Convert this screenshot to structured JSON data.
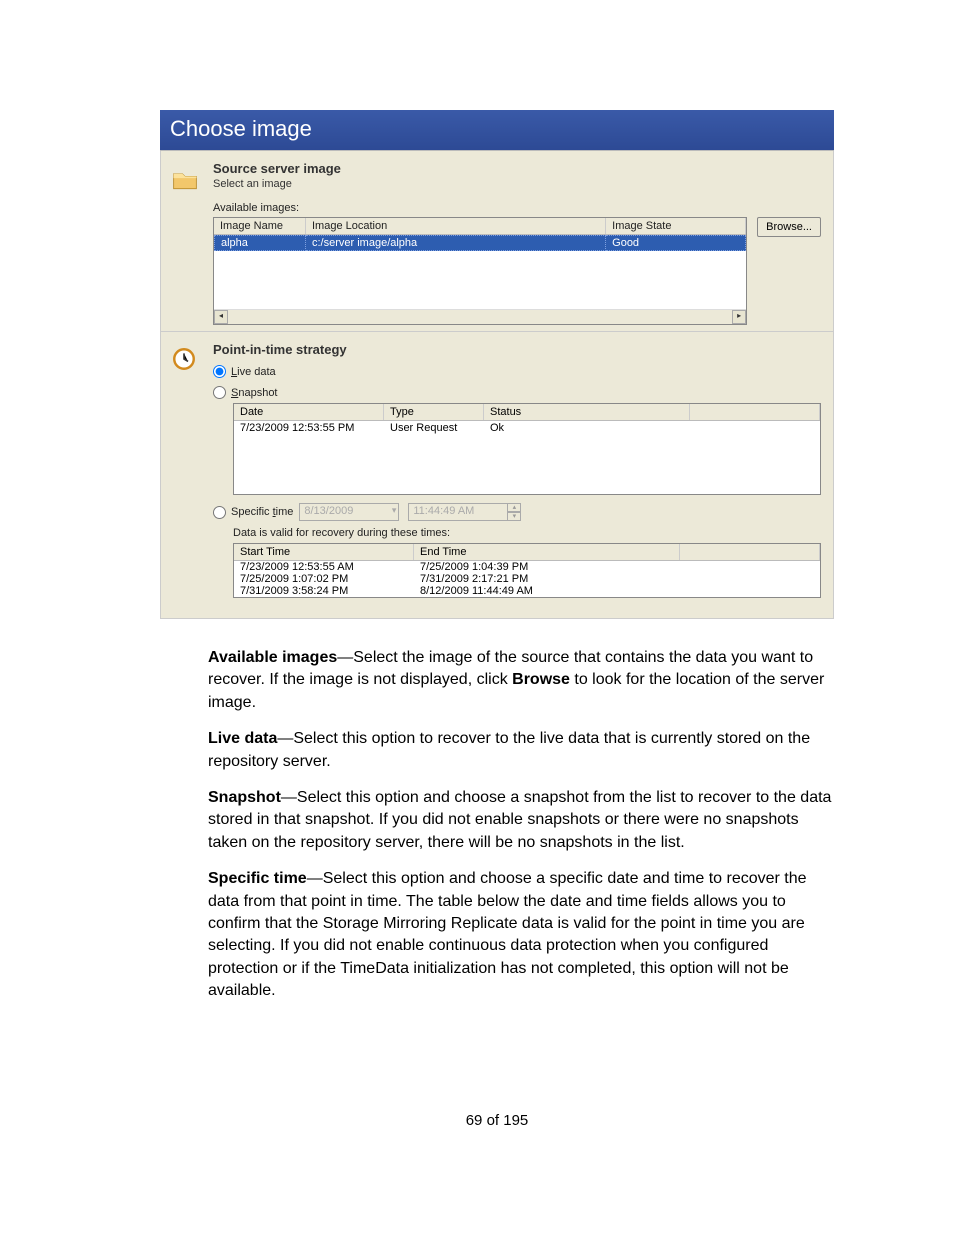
{
  "dialog": {
    "title": "Choose image",
    "section1": {
      "heading": "Source server image",
      "sub": "Select an image",
      "available_label": "Available images:",
      "browse": "Browse...",
      "headers": {
        "name": "Image Name",
        "location": "Image Location",
        "state": "Image State"
      },
      "row": {
        "name": "alpha",
        "location": "c:/server image/alpha",
        "state": "Good"
      }
    },
    "section2": {
      "heading": "Point-in-time strategy",
      "live_label": "Live data",
      "snapshot_label": "Snapshot",
      "snap_headers": {
        "date": "Date",
        "type": "Type",
        "status": "Status"
      },
      "snap_row": {
        "date": "7/23/2009 12:53:55 PM",
        "type": "User Request",
        "status": "Ok"
      },
      "specific_label": "Specific time",
      "specific_date": "8/13/2009",
      "specific_time": "11:44:49 AM",
      "valid_msg": "Data is valid for recovery during these times:",
      "time_headers": {
        "start": "Start Time",
        "end": "End Time"
      },
      "time_rows": [
        {
          "start": "7/23/2009 12:53:55 AM",
          "end": "7/25/2009 1:04:39 PM"
        },
        {
          "start": "7/25/2009 1:07:02 PM",
          "end": "7/31/2009 2:17:21 PM"
        },
        {
          "start": "7/31/2009 3:58:24 PM",
          "end": "8/12/2009 11:44:49 AM"
        }
      ]
    }
  },
  "doc": {
    "p1_b": "Available images",
    "p1": "—Select the image of the source that contains the data you want to recover. If the image is not displayed, click ",
    "p1_b2": "Browse",
    "p1_end": " to look for the location of the server image.",
    "p2_b": "Live data",
    "p2": "—Select this option to recover to the live data that is currently stored on the repository server.",
    "p3_b": "Snapshot",
    "p3": "—Select this option and choose a snapshot from the list to recover to the data stored in that snapshot. If you did not enable snapshots or there were no snapshots taken on the repository server, there will be no snapshots in the list.",
    "p4_b": "Specific time",
    "p4": "—Select this option and choose a specific date and time to recover the data from that point in time. The table below the date and time fields allows you to confirm that the Storage Mirroring Replicate data is valid for the point in time you are selecting. If you did not enable continuous data protection when you configured protection or if the TimeData initialization has not completed, this option will not be available.",
    "page_num": "69 of 195"
  }
}
